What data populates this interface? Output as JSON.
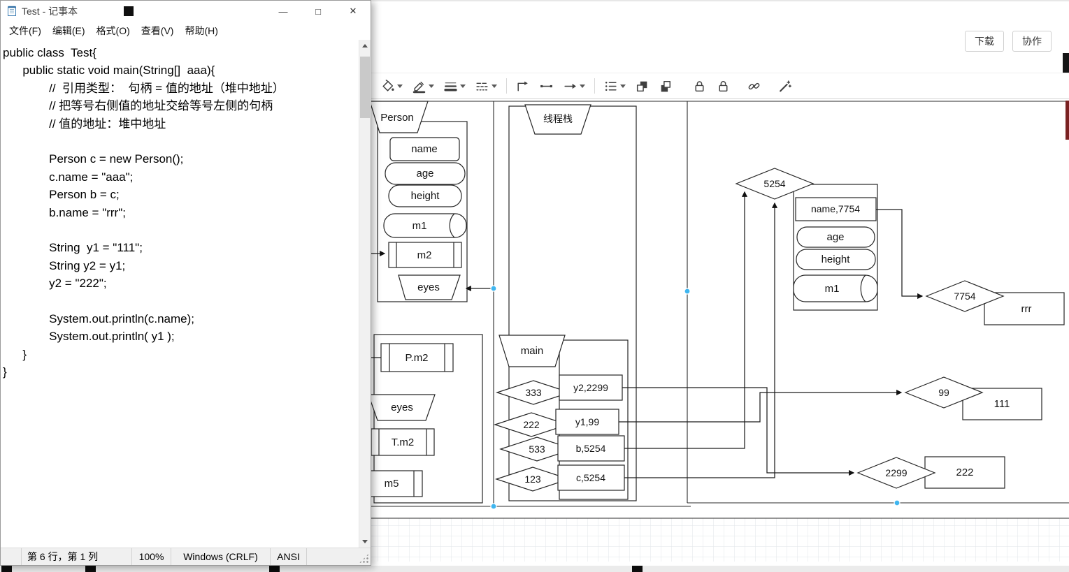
{
  "notepad": {
    "title": "Test - 记事本",
    "controls": {
      "minimize": "―",
      "maximize": "□",
      "close": "✕"
    },
    "menus": [
      "文件(F)",
      "编辑(E)",
      "格式(O)",
      "查看(V)",
      "帮助(H)"
    ],
    "code_lines": [
      "public class  Test{",
      "      public static void main(String[]  aaa){",
      "              //  引用类型：  句柄 = 值的地址（堆中地址）",
      "              // 把等号右侧值的地址交给等号左侧的句柄",
      "              // 值的地址：堆中地址",
      "",
      "              Person c = new Person();",
      "              c.name = \"aaa\";",
      "              Person b = c;",
      "              b.name = \"rrr\";",
      "",
      "              String  y1 = \"111\";",
      "              String y2 = y1;",
      "              y2 = \"222\";",
      "",
      "              System.out.println(c.name);",
      "              System.out.println( y1 );",
      "      }",
      "}"
    ],
    "status": {
      "line_col": "第 6 行，第 1 列",
      "zoom": "100%",
      "eol": "Windows (CRLF)",
      "encoding": "ANSI"
    }
  },
  "diagram_app": {
    "header": {
      "download": "下载",
      "collaborate": "协作"
    },
    "toolbar_icons": [
      "fill-color",
      "line-color",
      "line-weight",
      "line-style",
      "connector-elbow",
      "connector-line",
      "connector-arrow",
      "align",
      "bring-forward",
      "send-backward",
      "lock",
      "unlock",
      "link",
      "magic-wand"
    ],
    "colors": {
      "selection_handle": "#3fb6f0",
      "canvas_scrollbar_thumb": "#7a2222"
    },
    "diagram": {
      "heap_left_object": {
        "title": "Person",
        "name": "name",
        "age": "age",
        "height": "height",
        "m1": "m1",
        "m2": "m2",
        "eyes": "eyes"
      },
      "stack": {
        "title": "线程栈",
        "main": "main",
        "addr_y2": "333",
        "addr_y1": "222",
        "addr_b": "533",
        "addr_c": "123",
        "var_y2": "y2,2299",
        "var_y1": "y1,99",
        "var_b": "b,5254",
        "var_c": "c,5254"
      },
      "heap_bottom_left": {
        "pm2": "P.m2",
        "eyes": "eyes",
        "tm2": "T.m2",
        "m5": "m5"
      },
      "heap_right_object": {
        "addr": "5254",
        "name_field": "name,7754",
        "age": "age",
        "height": "height",
        "m1": "m1"
      },
      "strings": {
        "rrr_addr": "7754",
        "rrr_value": "rrr",
        "v111_addr": "99",
        "v111_value": "111",
        "v222_addr": "2299",
        "v222_value": "222"
      }
    }
  }
}
